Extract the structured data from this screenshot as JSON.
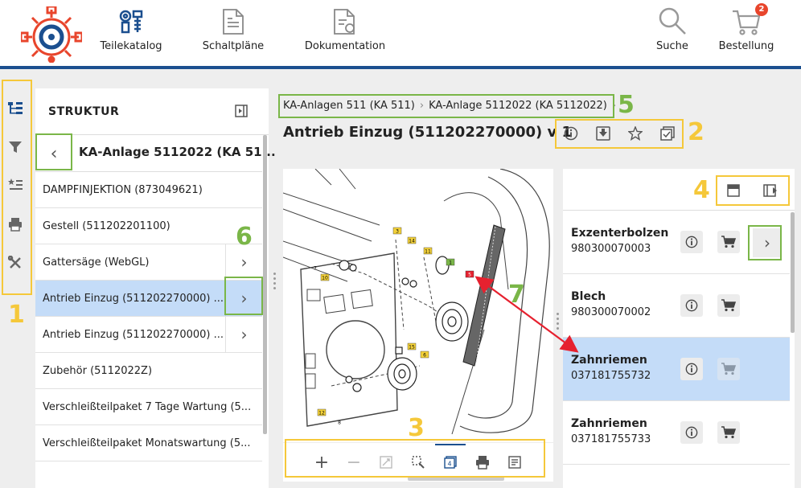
{
  "nav": {
    "items": [
      {
        "label": "Teilekatalog",
        "icon": "parts-catalog-icon"
      },
      {
        "label": "Schaltpläne",
        "icon": "schematic-document-icon"
      },
      {
        "label": "Dokumentation",
        "icon": "documentation-icon"
      },
      {
        "label": "Suche",
        "icon": "search-icon"
      },
      {
        "label": "Bestellung",
        "icon": "cart-icon"
      }
    ],
    "cart_count": "2",
    "brand_colors": {
      "logo_red": "#e8452c",
      "logo_blue": "#1b4f8f",
      "accent": "#1b4f8f"
    }
  },
  "left_toolbar": {
    "icons": [
      "structure-tree-icon",
      "filter-icon",
      "favorites-list-icon",
      "print-icon",
      "tools-icon"
    ]
  },
  "structure": {
    "heading": "STRUKTUR",
    "current": "KA-Anlage 5112022 (KA 51...",
    "items": [
      {
        "label": "DAMPFINJEKTION (873049621)",
        "has_children": false,
        "selected": false
      },
      {
        "label": "Gestell (511202201100)",
        "has_children": false,
        "selected": false
      },
      {
        "label": "Gattersäge (WebGL)",
        "has_children": true,
        "selected": false
      },
      {
        "label": "Antrieb Einzug (511202270000) ...",
        "has_children": true,
        "selected": true
      },
      {
        "label": "Antrieb Einzug (511202270000) ...",
        "has_children": true,
        "selected": false
      },
      {
        "label": "Zubehör (5112022Z)",
        "has_children": false,
        "selected": false
      },
      {
        "label": "Verschleißteilpaket 7 Tage Wartung (5...",
        "has_children": false,
        "selected": false
      },
      {
        "label": "Verschleißteilpaket Monatswartung (5...",
        "has_children": false,
        "selected": false
      }
    ]
  },
  "breadcrumb": [
    "KA-Anlagen 511 (KA 511)",
    "KA-Anlage 5112022 (KA 5112022)"
  ],
  "page": {
    "title": "Antrieb Einzug (511202270000) v 1"
  },
  "title_actions": [
    "info-icon",
    "download-icon",
    "star-icon",
    "checklist-icon"
  ],
  "drawing": {
    "callouts": [
      "3",
      "14",
      "11",
      "7",
      "10",
      "1",
      "5",
      "15",
      "6",
      "12",
      "8"
    ]
  },
  "viewer_tools": [
    "zoom-in-icon",
    "zoom-out-icon",
    "fit-icon",
    "zoom-area-icon",
    "page-icon",
    "print-icon",
    "list-icon"
  ],
  "parts": [
    {
      "name": "Exzenterbolzen",
      "number": "980300070003",
      "selected": false,
      "cart_enabled": true,
      "has_children": true
    },
    {
      "name": "Blech",
      "number": "980300070002",
      "selected": false,
      "cart_enabled": true,
      "has_children": false
    },
    {
      "name": "Zahnriemen",
      "number": "037181755732",
      "selected": true,
      "cart_enabled": false,
      "has_children": false
    },
    {
      "name": "Zahnriemen",
      "number": "037181755733",
      "selected": false,
      "cart_enabled": true,
      "has_children": false
    }
  ],
  "annotations": {
    "labels": [
      "1",
      "2",
      "3",
      "4",
      "5",
      "6",
      "7"
    ],
    "colors": {
      "yellow": "#f5c83a",
      "green": "#7ab648",
      "red": "#e6212f"
    }
  }
}
